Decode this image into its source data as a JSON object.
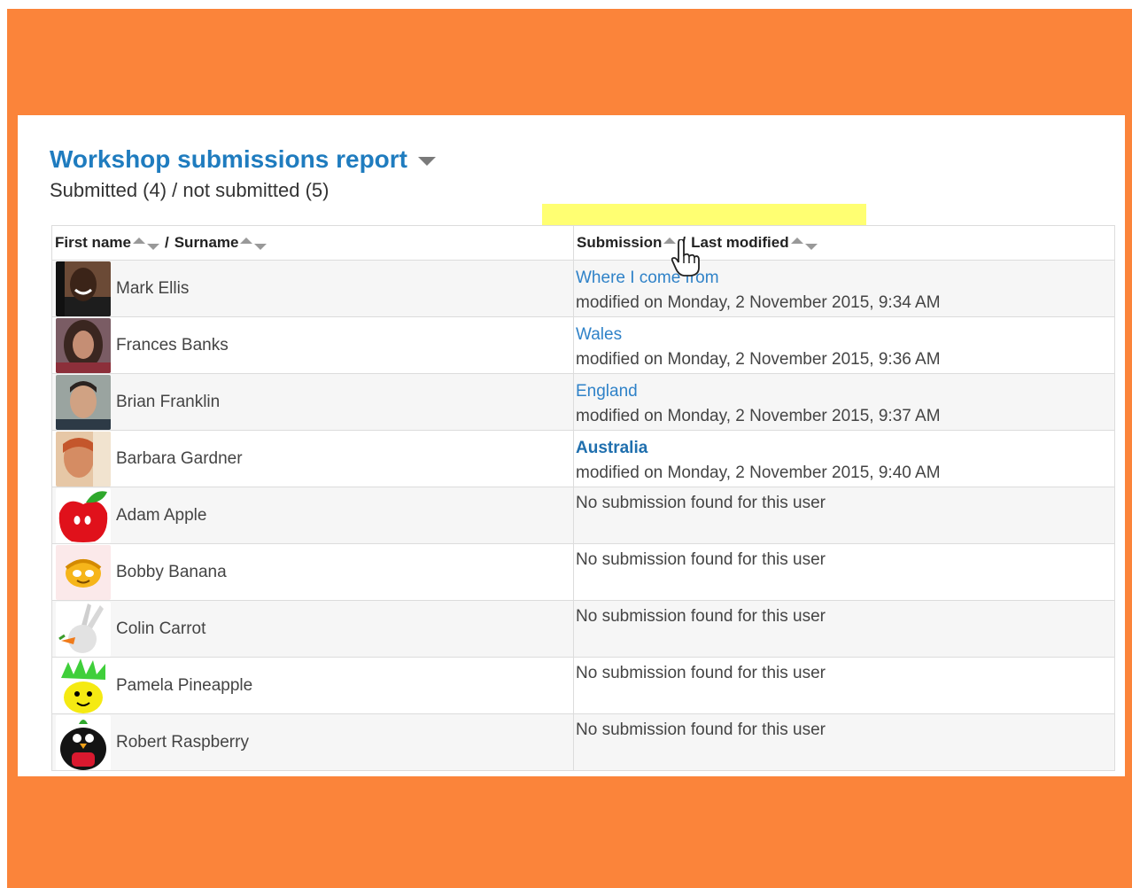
{
  "header": {
    "title": "Workshop submissions report",
    "summary": "Submitted (4) / not submitted (5)"
  },
  "columns": {
    "first_name": "First name",
    "separator": "/",
    "surname": "Surname",
    "submission": "Submission",
    "last_modified": "Last modified"
  },
  "rows": [
    {
      "name": "Mark Ellis",
      "avatar": "photo-avatar-man-smiling",
      "title": "Where I come from",
      "modified": "modified on Monday, 2 November 2015, 9:34 AM",
      "bold": false
    },
    {
      "name": "Frances Banks",
      "avatar": "photo-avatar-woman-curly-hair",
      "title": "Wales",
      "modified": "modified on Monday, 2 November 2015, 9:36 AM",
      "bold": false
    },
    {
      "name": "Brian Franklin",
      "avatar": "photo-avatar-man",
      "title": "England",
      "modified": "modified on Monday, 2 November 2015, 9:37 AM",
      "bold": false
    },
    {
      "name": "Barbara Gardner",
      "avatar": "photo-avatar-woman",
      "title": "Australia",
      "modified": "modified on Monday, 2 November 2015, 9:40 AM",
      "bold": true
    },
    {
      "name": "Adam Apple",
      "avatar": "apple-avatar",
      "no_submission": "No submission found for this user"
    },
    {
      "name": "Bobby Banana",
      "avatar": "banana-avatar",
      "no_submission": "No submission found for this user"
    },
    {
      "name": "Colin Carrot",
      "avatar": "rabbit-avatar",
      "no_submission": "No submission found for this user"
    },
    {
      "name": "Pamela Pineapple",
      "avatar": "pineapple-avatar",
      "no_submission": "No submission found for this user"
    },
    {
      "name": "Robert Raspberry",
      "avatar": "penguin-raspberry-avatar",
      "no_submission": "No submission found for this user"
    }
  ],
  "colors": {
    "frame": "#fb843a",
    "link": "#2f82c8",
    "title": "#1f7cbf",
    "highlight": "#ffff3c"
  }
}
